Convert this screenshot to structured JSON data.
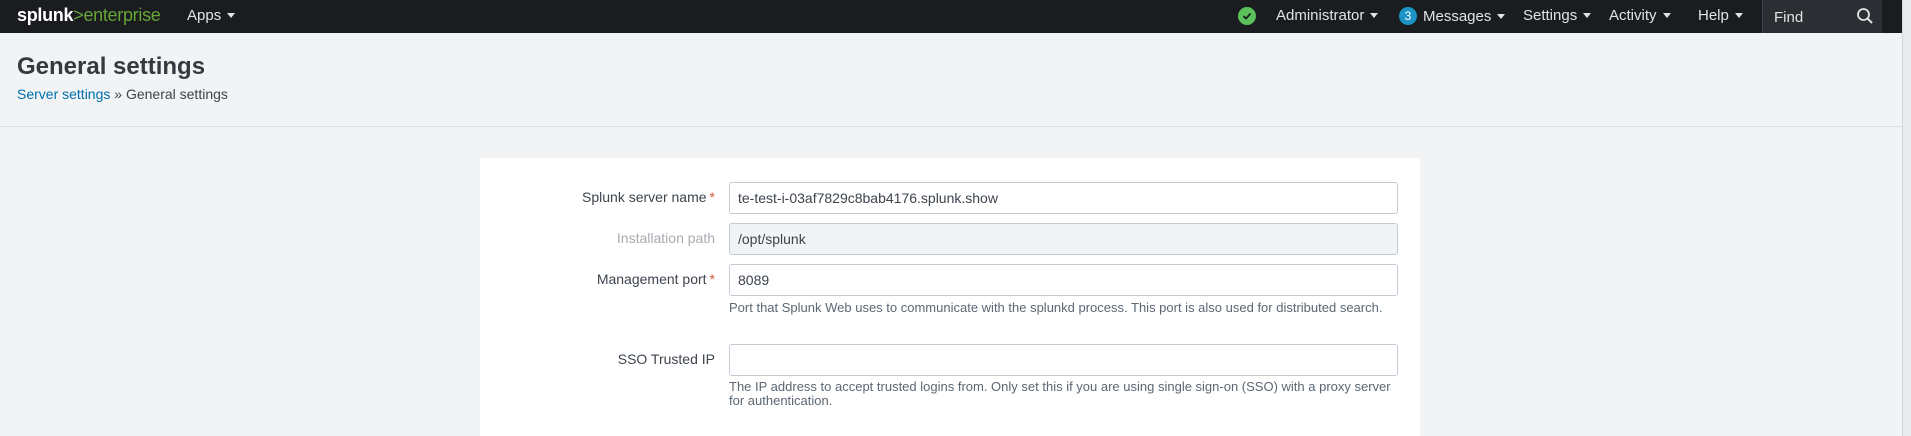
{
  "topbar": {
    "logo_splunk": "splunk",
    "logo_gt": ">",
    "logo_enterprise": "enterprise",
    "apps_label": "Apps",
    "admin_label": "Administrator",
    "messages_count": "3",
    "messages_label": "Messages",
    "settings_label": "Settings",
    "activity_label": "Activity",
    "help_label": "Help",
    "find_placeholder": "Find",
    "status_color": "#5cc05c",
    "badge_color": "#1e93c6"
  },
  "header": {
    "title": "General settings",
    "breadcrumb_link": "Server settings",
    "breadcrumb_sep": " » ",
    "breadcrumb_current": "General settings"
  },
  "form": {
    "server_name": {
      "label": "Splunk server name",
      "required": "*",
      "value": "te-test-i-03af7829c8bab4176.splunk.show"
    },
    "install_path": {
      "label": "Installation path",
      "value": "/opt/splunk"
    },
    "mgmt_port": {
      "label": "Management port",
      "required": "*",
      "value": "8089",
      "help": "Port that Splunk Web uses to communicate with the splunkd process. This port is also used for distributed search."
    },
    "sso_ip": {
      "label": "SSO Trusted IP",
      "value": "",
      "help": "The IP address to accept trusted logins from. Only set this if you are using single sign-on (SSO) with a proxy server for authentication."
    }
  }
}
